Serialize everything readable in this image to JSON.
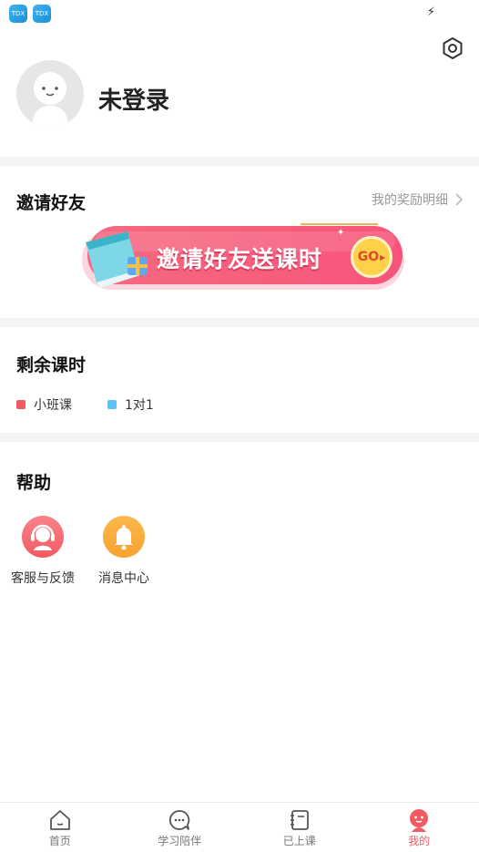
{
  "status_bar": {
    "badge_text": "TDX"
  },
  "profile": {
    "username": "未登录"
  },
  "invite": {
    "title": "邀请好友",
    "reward_link": "我的奖励明细",
    "banner_text": "邀请好友送课时",
    "banner_button": "GO"
  },
  "remaining": {
    "title": "剩余课时",
    "legend": [
      {
        "label": "小班课",
        "color": "#f25a62"
      },
      {
        "label": "1对1",
        "color": "#5fc2f5"
      }
    ]
  },
  "help": {
    "title": "帮助",
    "items": [
      {
        "label": "客服与反馈",
        "icon": "headset-icon"
      },
      {
        "label": "消息中心",
        "icon": "bell-icon"
      }
    ]
  },
  "tabs": [
    {
      "label": "首页",
      "icon": "home-icon",
      "active": false
    },
    {
      "label": "学习陪伴",
      "icon": "chat-icon",
      "active": false
    },
    {
      "label": "已上课",
      "icon": "notebook-icon",
      "active": false
    },
    {
      "label": "我的",
      "icon": "profile-face-icon",
      "active": true
    }
  ],
  "colors": {
    "accent": "#f25a62",
    "blue": "#5fc2f5",
    "orange": "#f7a12f"
  }
}
